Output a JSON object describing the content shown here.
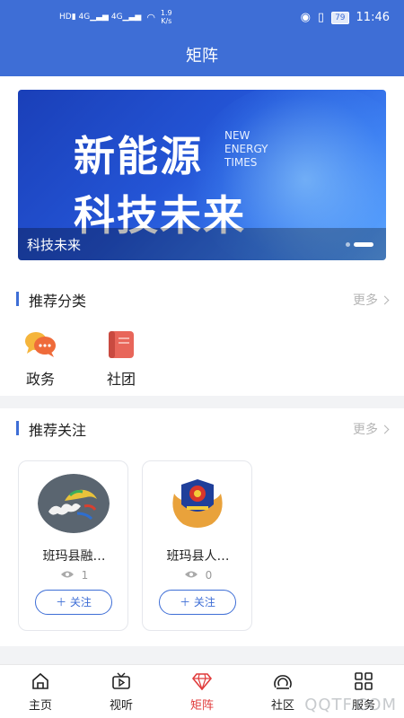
{
  "status_bar": {
    "net_speed_value": "1.9",
    "net_speed_unit": "K/s",
    "battery": "79",
    "time": "11:46"
  },
  "header": {
    "title": "矩阵"
  },
  "banner": {
    "headline_line1": "新能源",
    "headline_line2": "科技未来",
    "english_line1": "NEW",
    "english_line2": "ENERGY",
    "english_line3": "TIMES",
    "caption": "科技未来"
  },
  "categories": {
    "title": "推荐分类",
    "more_label": "更多",
    "items": [
      {
        "label": "政务",
        "icon": "chat-bubbles-icon"
      },
      {
        "label": "社团",
        "icon": "book-icon"
      }
    ]
  },
  "follows": {
    "title": "推荐关注",
    "more_label": "更多",
    "items": [
      {
        "name": "班玛县融…",
        "views": "1",
        "button_label": "关注",
        "avatar": "clouds-logo"
      },
      {
        "name": "班玛县人…",
        "views": "0",
        "button_label": "关注",
        "avatar": "police-emblem"
      }
    ]
  },
  "tabbar": {
    "items": [
      {
        "label": "主页",
        "icon": "home-icon"
      },
      {
        "label": "视听",
        "icon": "video-icon"
      },
      {
        "label": "矩阵",
        "icon": "diamond-icon",
        "active": true
      },
      {
        "label": "社区",
        "icon": "community-icon"
      },
      {
        "label": "服务",
        "icon": "grid-icon"
      }
    ]
  },
  "colors": {
    "brand_blue": "#3e6ed6",
    "active_tab_red": "#e03c3c"
  },
  "watermark": "QQTF.COM"
}
